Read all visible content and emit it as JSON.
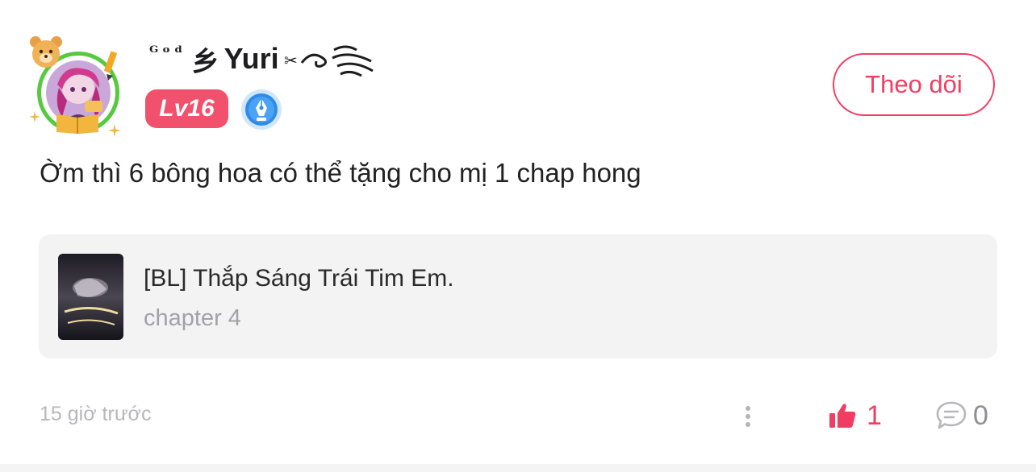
{
  "user": {
    "name_prefix": "ᴳᵒᵈ",
    "name_glyph": "乡",
    "name": "Yuri",
    "name_suffix": "༄",
    "level": "Lv16"
  },
  "follow_label": "Theo dõi",
  "comment": {
    "text": "Ờm thì 6 bông hoa có thể tặng cho mị 1 chap hong",
    "timestamp": "15 giờ trước",
    "like_count": "1",
    "reply_count": "0"
  },
  "story": {
    "title": "[BL] Thắp Sáng Trái Tim Em.",
    "chapter": "chapter 4"
  },
  "colors": {
    "accent": "#f23d63",
    "level_badge": "#f1516c",
    "avatar_ring": "#57c93f",
    "card_bg": "#f3f3f4",
    "muted_text": "#b7b7bb"
  },
  "icons": [
    "bear-icon",
    "pencil-icon",
    "writer-badge-icon",
    "more-vertical-icon",
    "thumbs-up-icon",
    "comment-bubble-icon"
  ]
}
